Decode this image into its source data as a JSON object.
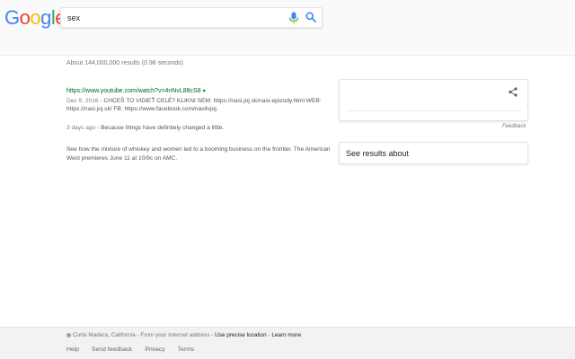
{
  "logo": {
    "letters": [
      "G",
      "o",
      "o",
      "g",
      "l",
      "e"
    ]
  },
  "search": {
    "query": "sex"
  },
  "results_stats": "About 144,000,000 results (0.98 seconds)",
  "results": [
    {
      "url": "https://www.youtube.com/watch?v=4nNvL88cS8",
      "caret": "▾",
      "date": "Dec 9, 2016",
      "snippet": "CHCEŠ TO VIDIEŤ CELÉ? KLIKNI SEM: https://nasi.joj.sk/nasi-epizody.html WEB: https://nasi.joj.sk/ FB: https://www.facebook.com/nasitvjoj."
    },
    {
      "date": "3 days ago",
      "snippet": "Because things have definitely changed a little."
    },
    {
      "snippet": "See how the mixture of whiskey and women led to a booming business on the frontier. The American West premieres June 11 at 10/9c on AMC."
    }
  ],
  "knowledge_panel": {
    "feedback": "Feedback",
    "see_results_about": "See results about"
  },
  "footer": {
    "location": "Corte Madera, California",
    "location_source": "From your Internet address",
    "precise": "Use precise location",
    "learn_more": "Learn more",
    "links": [
      "Help",
      "Send feedback",
      "Privacy",
      "Terms"
    ]
  },
  "colors": {
    "blue": "#4285F4",
    "red": "#EA4335",
    "yellow": "#FBBC05",
    "green": "#34A853",
    "url_green": "#006621"
  }
}
